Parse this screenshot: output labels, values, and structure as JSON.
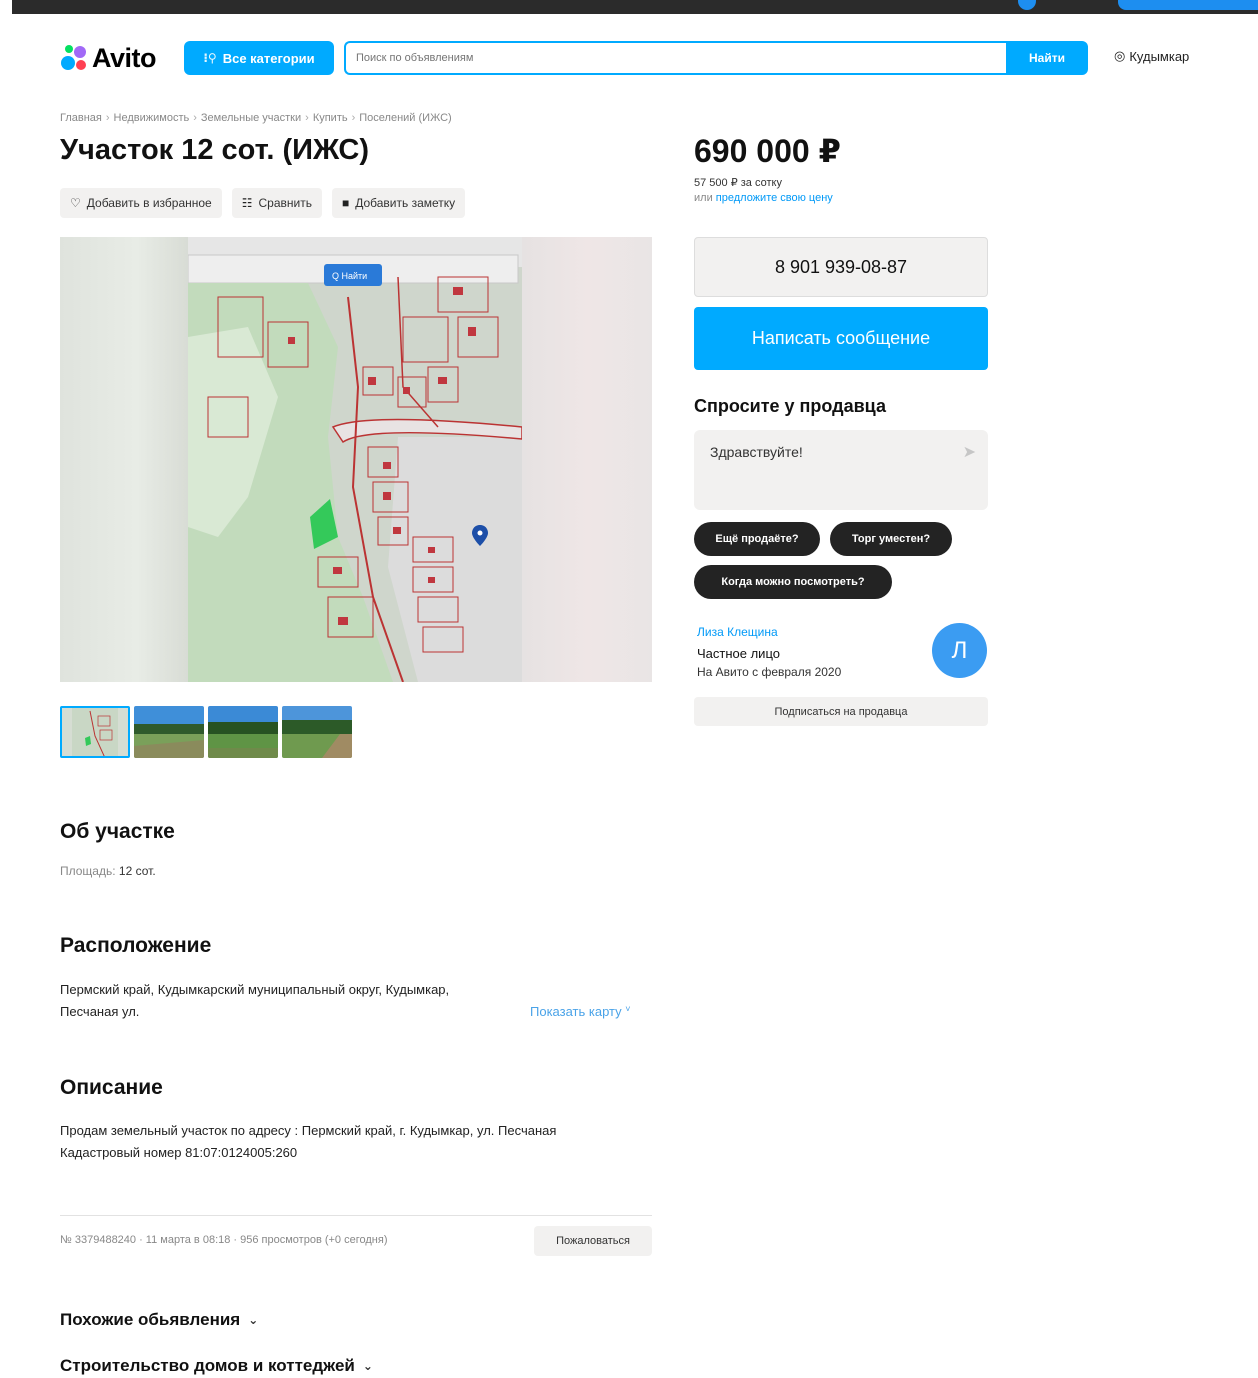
{
  "header": {
    "logo_text": "Avito",
    "categories_label": "Все категории",
    "search_placeholder": "Поиск по объявлениям",
    "search_button": "Найти",
    "location": "Кудымкар"
  },
  "breadcrumb": [
    "Главная",
    "Недвижимость",
    "Земельные участки",
    "Купить",
    "Поселений (ИЖС)"
  ],
  "listing": {
    "title": "Участок 12 сот. (ИЖС)",
    "price": "690 000 ₽",
    "price_per_unit": "57 500 ₽ за сотку",
    "offer_prefix": "или",
    "offer_link": "предложите свою цену"
  },
  "actions": {
    "favorite": "Добавить в избранное",
    "compare": "Сравнить",
    "note": "Добавить заметку"
  },
  "gallery": {
    "map_search_button": "Q Найти",
    "thumbnail_count": 4,
    "active_thumbnail": 1
  },
  "contact": {
    "phone": "8 901 939-08-87",
    "message_button": "Написать сообщение",
    "ask_title": "Спросите у продавца",
    "ask_text": "Здравствуйте!",
    "quick_questions": [
      "Ещё продаёте?",
      "Торг уместен?",
      "Когда можно посмотреть?"
    ]
  },
  "seller": {
    "name": "Лиза Клещина",
    "type": "Частное лицо",
    "since": "На Авито с февраля 2020",
    "avatar_letter": "Л",
    "subscribe": "Подписаться на продавца"
  },
  "about": {
    "title": "Об участке",
    "area_label": "Площадь:",
    "area_value": "12 сот."
  },
  "location_section": {
    "title": "Расположение",
    "address_line1": "Пермский край, Кудымкарский муниципальный округ, Кудымкар,",
    "address_line2": "Песчаная ул.",
    "show_map": "Показать карту"
  },
  "description": {
    "title": "Описание",
    "line1": "Продам земельный участок по адресу : Пермский край, г. Кудымкар, ул. Песчаная",
    "line2": "Кадастровый номер 81:07:0124005:260"
  },
  "footer_meta": {
    "info": "№ 3379488240 · 11 марта в 08:18 · 956 просмотров (+0 сегодня)",
    "report": "Пожаловаться"
  },
  "accordions": {
    "similar": "Похожие обьявления",
    "construction": "Строительство домов и коттеджей"
  },
  "colors": {
    "accent": "#00aaff",
    "link": "#0099f7",
    "chip": "#232323",
    "avatar": "#3b9cf2",
    "button_gray": "#f2f1f0"
  },
  "icons": {
    "categories": "search-icon",
    "location": "location-pin-icon",
    "favorite": "heart-icon",
    "compare": "compare-icon",
    "note": "note-icon",
    "send": "send-icon",
    "map_marker": "map-marker-icon",
    "accordion": "chevron-down-icon"
  }
}
